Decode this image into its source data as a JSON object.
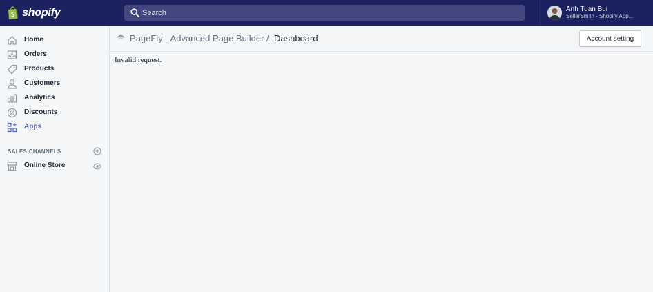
{
  "topbar": {
    "logo_text": "shopify",
    "search_placeholder": "Search",
    "user_name": "Anh Tuan Bui",
    "user_store": "SellerSmith - Shopify App..."
  },
  "sidebar": {
    "items": [
      {
        "label": "Home",
        "icon": "home-icon"
      },
      {
        "label": "Orders",
        "icon": "orders-icon"
      },
      {
        "label": "Products",
        "icon": "tag-icon"
      },
      {
        "label": "Customers",
        "icon": "person-icon"
      },
      {
        "label": "Analytics",
        "icon": "bar-chart-icon"
      },
      {
        "label": "Discounts",
        "icon": "discount-icon"
      },
      {
        "label": "Apps",
        "icon": "apps-icon",
        "active": true
      }
    ],
    "sales_channels_label": "SALES CHANNELS",
    "channels": [
      {
        "label": "Online Store",
        "icon": "store-icon"
      }
    ]
  },
  "header": {
    "app_name": "PageFly - Advanced Page Builder",
    "separator": "/",
    "page_title": "Dashboard",
    "account_button": "Account setting"
  },
  "main": {
    "message": "Invalid request."
  },
  "colors": {
    "topbar": "#1c2260",
    "search_bg": "#43467f",
    "active_nav": "#5c6ac4",
    "background": "#f4f6f8"
  }
}
